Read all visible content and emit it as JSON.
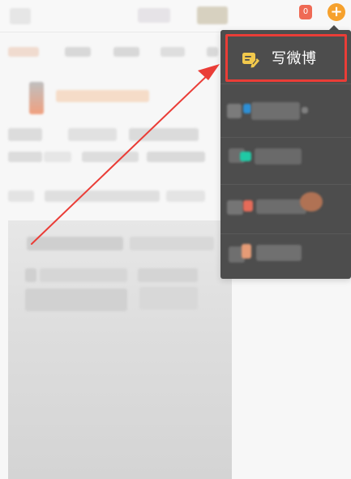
{
  "topbar": {
    "notification_count": "0",
    "add_button_label": "+"
  },
  "menu": {
    "compose_label": "写微博"
  },
  "colors": {
    "accent_orange": "#f6a12d",
    "highlight_red": "#ea3d37",
    "menu_bg": "#4d4d4d",
    "menu_text": "#ffffff",
    "compose_icon": "#f2c94c",
    "teal": "#20c9a5",
    "blue": "#2d8fd5",
    "coral": "#e66b59",
    "peach": "#e69b76"
  },
  "icons": {
    "compose": "compose-icon",
    "add": "add-icon",
    "notification": "notification-icon",
    "arrow": "annotation-arrow-icon"
  }
}
